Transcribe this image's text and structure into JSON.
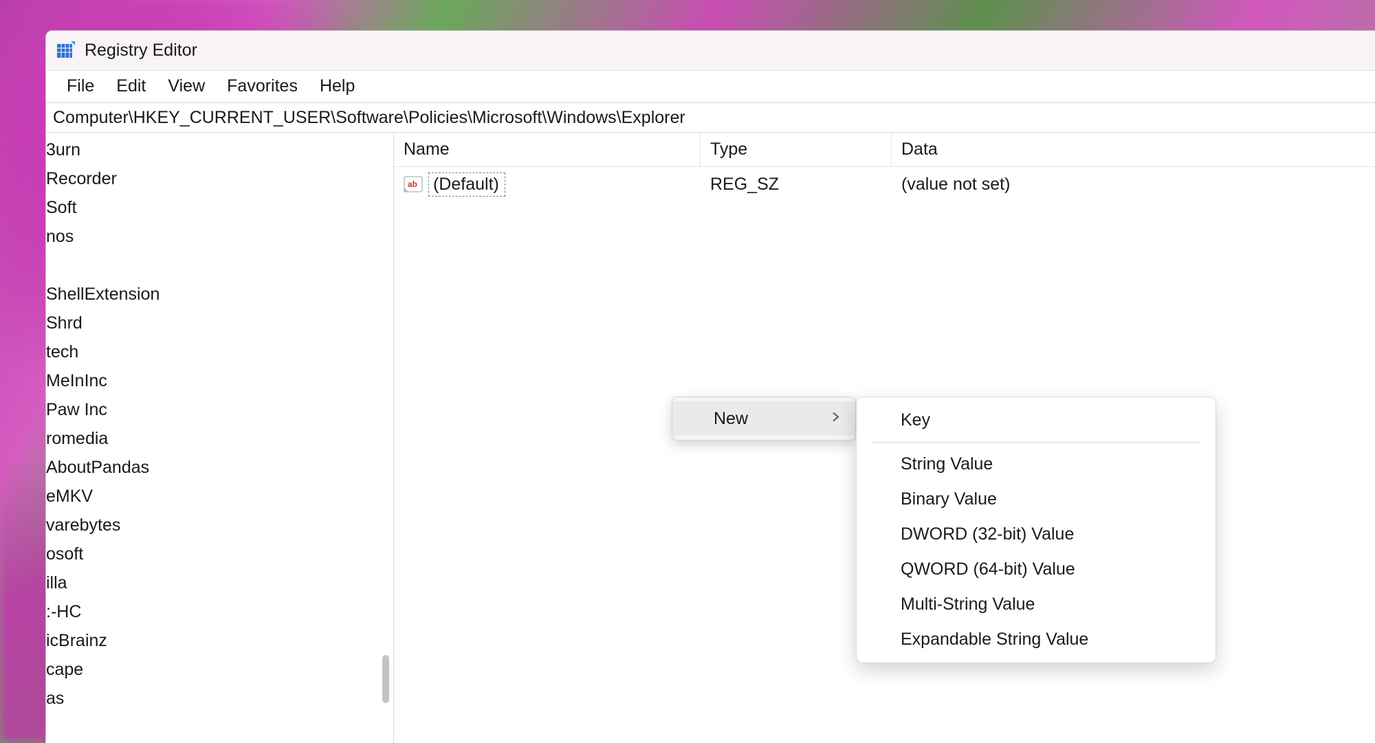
{
  "app": {
    "title": "Registry Editor"
  },
  "menubar": {
    "file": "File",
    "edit": "Edit",
    "view": "View",
    "favorites": "Favorites",
    "help": "Help"
  },
  "address": "Computer\\HKEY_CURRENT_USER\\Software\\Policies\\Microsoft\\Windows\\Explorer",
  "tree": {
    "items": [
      "3urn",
      "Recorder",
      "Soft",
      "nos",
      "",
      "ShellExtension",
      "Shrd",
      "tech",
      "MeInInc",
      "Paw Inc",
      "romedia",
      "AboutPandas",
      "eMKV",
      "varebytes",
      "osoft",
      "illa",
      ":-HC",
      "icBrainz",
      "cape",
      "as"
    ]
  },
  "list": {
    "columns": {
      "name": "Name",
      "type": "Type",
      "data": "Data"
    },
    "rows": [
      {
        "name": "(Default)",
        "type": "REG_SZ",
        "data": "(value not set)"
      }
    ]
  },
  "context_menu": {
    "new": "New",
    "sub": {
      "key": "Key",
      "string": "String Value",
      "binary": "Binary Value",
      "dword": "DWORD (32-bit) Value",
      "qword": "QWORD (64-bit) Value",
      "multi": "Multi-String Value",
      "expand": "Expandable String Value"
    }
  }
}
